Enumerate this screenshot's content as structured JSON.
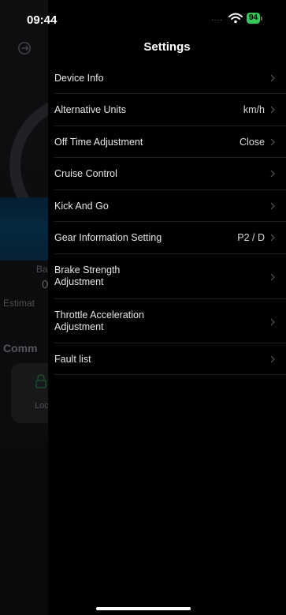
{
  "status_bar": {
    "time": "09:44",
    "signal_dots": "....",
    "battery_level": "94"
  },
  "background_screen": {
    "battery_label_fragment": "Ba",
    "battery_value_fragment": "0",
    "estimate_fragment": "Estimat",
    "commands_fragment": "Comm",
    "lock_card_fragment": "Loc"
  },
  "settings": {
    "title": "Settings",
    "items": [
      {
        "label": "Device Info",
        "value": ""
      },
      {
        "label": "Alternative Units",
        "value": "km/h"
      },
      {
        "label": "Off Time Adjustment",
        "value": "Close"
      },
      {
        "label": "Cruise Control",
        "value": ""
      },
      {
        "label": "Kick And Go",
        "value": ""
      },
      {
        "label": "Gear Information Setting",
        "value": "P2 / D"
      },
      {
        "label": "Brake Strength Adjustment",
        "value": ""
      },
      {
        "label": "Throttle Acceleration Adjustment",
        "value": ""
      },
      {
        "label": "Fault list",
        "value": ""
      }
    ]
  },
  "colors": {
    "battery_green": "#34c759",
    "background": "#000000",
    "accent_blue": "#0a4a74"
  }
}
